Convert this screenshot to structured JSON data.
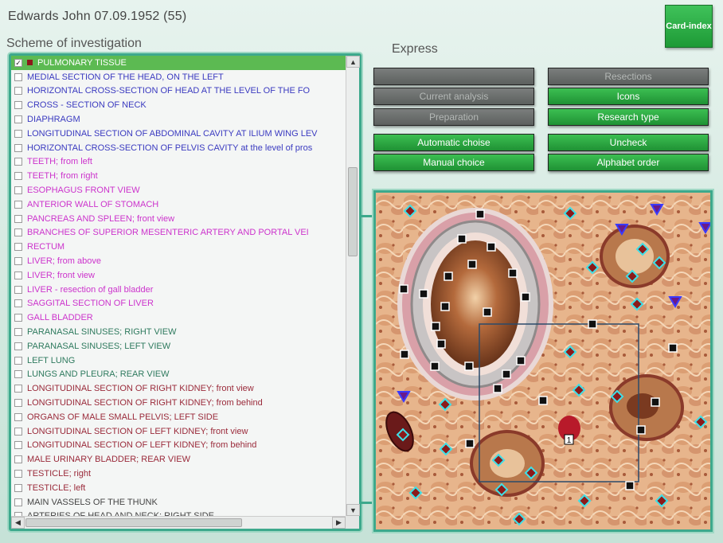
{
  "header": {
    "patient": "Edwards John  07.09.1952 (55)",
    "scheme_title": "Scheme of investigation",
    "express_title": "Express",
    "card_index": "Card-index"
  },
  "colors": {
    "accent_green": "#2aaa44",
    "panel_border": "#3da98c",
    "selected_row": "#5cba52",
    "marker_dark_red": "#8b1a1a"
  },
  "list": {
    "items": [
      {
        "label": "PULMONARY TISSUE",
        "color": "#ffffff",
        "checked": true,
        "selected": true
      },
      {
        "label": "MEDIAL SECTION OF THE HEAD, ON THE LEFT",
        "color": "#3a3ac0"
      },
      {
        "label": "HORIZONTAL CROSS-SECTION OF HEAD AT THE LEVEL OF THE FO",
        "color": "#3a3ac0"
      },
      {
        "label": "CROSS - SECTION  OF  NECK",
        "color": "#3a3ac0"
      },
      {
        "label": "DIAPHRAGM",
        "color": "#3a3ac0"
      },
      {
        "label": "LONGITUDINAL SECTION OF ABDOMINAL CAVITY AT ILIUM WING LEV",
        "color": "#3a3ac0"
      },
      {
        "label": "HORIZONTAL CROSS-SECTION OF PELVIS CAVITY at the level of pros",
        "color": "#3a3ac0"
      },
      {
        "label": "TEETH; from left",
        "color": "#cc33cc"
      },
      {
        "label": "TEETH; from right",
        "color": "#cc33cc"
      },
      {
        "label": "ESOPHAGUS FRONT VIEW",
        "color": "#cc33cc"
      },
      {
        "label": "ANTERIOR  WALL  OF  STOMACH",
        "color": "#cc33cc"
      },
      {
        "label": "PANCREAS  AND  SPLEEN;  front  view",
        "color": "#cc33cc"
      },
      {
        "label": "BRANCHES OF SUPERIOR MESENTERIC ARTERY AND PORTAL VEI",
        "color": "#cc33cc"
      },
      {
        "label": "RECTUM",
        "color": "#cc33cc"
      },
      {
        "label": "LIVER;  from above",
        "color": "#cc33cc"
      },
      {
        "label": "LIVER; front  view",
        "color": "#cc33cc"
      },
      {
        "label": "LIVER - resection of gall bladder",
        "color": "#cc33cc"
      },
      {
        "label": "SAGGITAL  SECTION  OF  LIVER",
        "color": "#cc33cc"
      },
      {
        "label": "GALL BLADDER",
        "color": "#cc33cc"
      },
      {
        "label": "PARANASAL SINUSES; RIGHT VIEW",
        "color": "#2e7a5e"
      },
      {
        "label": "PARANASAL SINUSES; LEFT VIEW",
        "color": "#2e7a5e"
      },
      {
        "label": "LEFT  LUNG",
        "color": "#2e7a5e"
      },
      {
        "label": "LUNGS AND PLEURA; REAR VIEW",
        "color": "#2e7a5e"
      },
      {
        "label": "LONGITUDINAL  SECTION  OF  RIGHT  KIDNEY; front view",
        "color": "#9a2a3a"
      },
      {
        "label": "LONGITUDINAL  SECTION  OF  RIGHT  KIDNEY; from behind",
        "color": "#9a2a3a"
      },
      {
        "label": "ORGANS OF MALE SMALL PELVIS; LEFT SIDE",
        "color": "#9a2a3a"
      },
      {
        "label": "LONGITUDINAL  SECTION  OF  LEFT KIDNEY; front view",
        "color": "#9a2a3a"
      },
      {
        "label": "LONGITUDINAL  SECTION  OF  LEFT KIDNEY; from behind",
        "color": "#9a2a3a"
      },
      {
        "label": "MALE URINARY BLADDER; REAR VIEW",
        "color": "#9a2a3a"
      },
      {
        "label": "TESTICLE; right",
        "color": "#9a2a3a"
      },
      {
        "label": "TESTICLE; left",
        "color": "#9a2a3a"
      },
      {
        "label": "MAIN  VASSELS  OF  THE  THUNK",
        "color": "#444444"
      },
      {
        "label": "ARTERIES OF HEAD AND NECK; RIGHT SIDE",
        "color": "#444444"
      }
    ]
  },
  "buttons": {
    "blank": "",
    "current_analysis": "Current analysis",
    "preparation": "Preparation",
    "automatic_choise": "Automatic choise",
    "manual_choice": "Manual choice",
    "resections": "Resections",
    "icons": "Icons",
    "research_type": "Research type",
    "uncheck": "Uncheck",
    "alphabet_order": "Alphabet order"
  },
  "scroll": {
    "up": "▲",
    "down": "▼",
    "left": "◀",
    "right": "▶"
  },
  "image": {
    "marker_label": "1"
  }
}
